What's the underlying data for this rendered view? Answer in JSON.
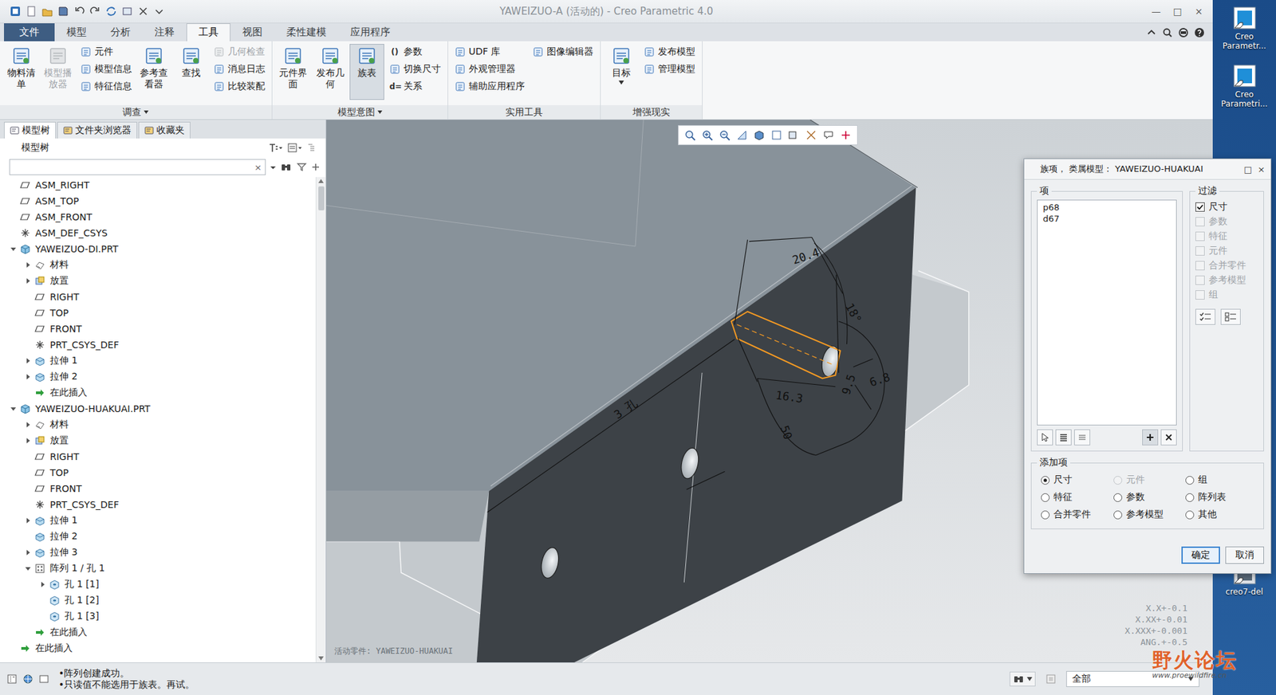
{
  "window": {
    "title": "YAWEIZUO-A (活动的) - Creo Parametric 4.0",
    "controls": [
      "—",
      "□",
      "×"
    ]
  },
  "ribbon": {
    "tabs": [
      {
        "label": "文件",
        "selected": false,
        "kind": "file"
      },
      {
        "label": "模型",
        "selected": false,
        "kind": "tab"
      },
      {
        "label": "分析",
        "selected": false,
        "kind": "tab"
      },
      {
        "label": "注释",
        "selected": false,
        "kind": "tab"
      },
      {
        "label": "工具",
        "selected": true,
        "kind": "tab"
      },
      {
        "label": "视图",
        "selected": false,
        "kind": "tab"
      },
      {
        "label": "柔性建模",
        "selected": false,
        "kind": "tab"
      },
      {
        "label": "应用程序",
        "selected": false,
        "kind": "tab"
      }
    ],
    "groups": [
      {
        "title": "调查",
        "dropdown": true,
        "items": [
          {
            "kind": "large",
            "label": "物料清单",
            "disabled": false,
            "selected": false,
            "menu": false
          },
          {
            "kind": "large",
            "label": "模型播放器",
            "disabled": true,
            "selected": false,
            "menu": false
          },
          {
            "kind": "column",
            "buttons": [
              {
                "label": "元件",
                "disabled": false
              },
              {
                "label": "模型信息",
                "disabled": false
              },
              {
                "label": "特征信息",
                "disabled": false
              }
            ]
          },
          {
            "kind": "large",
            "label": "参考查看器",
            "disabled": false,
            "selected": false,
            "menu": false
          },
          {
            "kind": "large",
            "label": "查找",
            "disabled": false,
            "selected": false,
            "menu": false
          },
          {
            "kind": "column",
            "buttons": [
              {
                "label": "几何检查",
                "disabled": true
              },
              {
                "label": "消息日志",
                "disabled": false
              },
              {
                "label": "比较装配",
                "disabled": false
              }
            ]
          }
        ]
      },
      {
        "title": "模型意图",
        "dropdown": true,
        "items": [
          {
            "kind": "large",
            "label": "元件界面",
            "disabled": false,
            "selected": false,
            "menu": false
          },
          {
            "kind": "large",
            "label": "发布几何",
            "disabled": false,
            "selected": false,
            "menu": false
          },
          {
            "kind": "large",
            "label": "族表",
            "disabled": false,
            "selected": true,
            "menu": false
          },
          {
            "kind": "column",
            "buttons": [
              {
                "label": "参数",
                "disabled": false,
                "glyph": "()"
              },
              {
                "label": "切换尺寸",
                "disabled": false
              },
              {
                "label": "关系",
                "disabled": false,
                "glyph": "d="
              }
            ]
          }
        ]
      },
      {
        "title": "实用工具",
        "dropdown": false,
        "items": [
          {
            "kind": "column",
            "buttons": [
              {
                "label": "UDF 库",
                "disabled": false
              },
              {
                "label": "外观管理器",
                "disabled": false
              },
              {
                "label": "辅助应用程序",
                "disabled": false
              }
            ]
          },
          {
            "kind": "column",
            "buttons": [
              {
                "label": "图像编辑器",
                "disabled": false
              }
            ]
          }
        ]
      },
      {
        "title": "增强现实",
        "dropdown": false,
        "items": [
          {
            "kind": "large",
            "label": "目标",
            "disabled": false,
            "selected": false,
            "menu": true
          },
          {
            "kind": "column",
            "buttons": [
              {
                "label": "发布模型",
                "disabled": false
              },
              {
                "label": "管理模型",
                "disabled": false
              }
            ]
          }
        ]
      }
    ]
  },
  "panel": {
    "tabs": [
      {
        "label": "模型树",
        "selected": true
      },
      {
        "label": "文件夹浏览器",
        "selected": false
      },
      {
        "label": "收藏夹",
        "selected": false
      }
    ],
    "header": "模型树",
    "search": {
      "value": "",
      "clear": "×"
    },
    "tree": [
      {
        "label": "ASM_RIGHT",
        "level": 0,
        "kind": "plane",
        "expandable": false,
        "expanded": false
      },
      {
        "label": "ASM_TOP",
        "level": 0,
        "kind": "plane",
        "expandable": false,
        "expanded": false
      },
      {
        "label": "ASM_FRONT",
        "level": 0,
        "kind": "plane",
        "expandable": false,
        "expanded": false
      },
      {
        "label": "ASM_DEF_CSYS",
        "level": 0,
        "kind": "csys",
        "expandable": false,
        "expanded": false
      },
      {
        "label": "YAWEIZUO-DI.PRT",
        "level": 0,
        "kind": "part",
        "expandable": true,
        "expanded": true
      },
      {
        "label": "材料",
        "level": 1,
        "kind": "material",
        "expandable": true,
        "expanded": false
      },
      {
        "label": "放置",
        "level": 1,
        "kind": "placement",
        "expandable": true,
        "expanded": false
      },
      {
        "label": "RIGHT",
        "level": 1,
        "kind": "plane",
        "expandable": false,
        "expanded": false
      },
      {
        "label": "TOP",
        "level": 1,
        "kind": "plane",
        "expandable": false,
        "expanded": false
      },
      {
        "label": "FRONT",
        "level": 1,
        "kind": "plane",
        "expandable": false,
        "expanded": false
      },
      {
        "label": "PRT_CSYS_DEF",
        "level": 1,
        "kind": "csys",
        "expandable": false,
        "expanded": false
      },
      {
        "label": "拉伸 1",
        "level": 1,
        "kind": "extrude",
        "expandable": true,
        "expanded": false
      },
      {
        "label": "拉伸 2",
        "level": 1,
        "kind": "extrude",
        "expandable": true,
        "expanded": false
      },
      {
        "label": "在此插入",
        "level": 1,
        "kind": "insert",
        "expandable": false,
        "expanded": false
      },
      {
        "label": "YAWEIZUO-HUAKUAI.PRT",
        "level": 0,
        "kind": "part",
        "expandable": true,
        "expanded": true
      },
      {
        "label": "材料",
        "level": 1,
        "kind": "material",
        "expandable": true,
        "expanded": false
      },
      {
        "label": "放置",
        "level": 1,
        "kind": "placement",
        "expandable": true,
        "expanded": false
      },
      {
        "label": "RIGHT",
        "level": 1,
        "kind": "plane",
        "expandable": false,
        "expanded": false
      },
      {
        "label": "TOP",
        "level": 1,
        "kind": "plane",
        "expandable": false,
        "expanded": false
      },
      {
        "label": "FRONT",
        "level": 1,
        "kind": "plane",
        "expandable": false,
        "expanded": false
      },
      {
        "label": "PRT_CSYS_DEF",
        "level": 1,
        "kind": "csys",
        "expandable": false,
        "expanded": false
      },
      {
        "label": "拉伸 1",
        "level": 1,
        "kind": "extrude",
        "expandable": true,
        "expanded": false
      },
      {
        "label": "拉伸 2",
        "level": 1,
        "kind": "extrude",
        "expandable": false,
        "expanded": false
      },
      {
        "label": "拉伸 3",
        "level": 1,
        "kind": "extrude",
        "expandable": true,
        "expanded": false
      },
      {
        "label": "阵列 1 / 孔 1",
        "level": 1,
        "kind": "pattern",
        "expandable": true,
        "expanded": true
      },
      {
        "label": "孔 1 [1]",
        "level": 2,
        "kind": "hole",
        "expandable": true,
        "expanded": false
      },
      {
        "label": "孔 1 [2]",
        "level": 2,
        "kind": "hole",
        "expandable": false,
        "expanded": false
      },
      {
        "label": "孔 1 [3]",
        "level": 2,
        "kind": "hole",
        "expandable": false,
        "expanded": false
      },
      {
        "label": "在此插入",
        "level": 1,
        "kind": "insert",
        "expandable": false,
        "expanded": false
      },
      {
        "label": "在此插入",
        "level": 0,
        "kind": "insert",
        "expandable": false,
        "expanded": false
      }
    ]
  },
  "graphics": {
    "active_part": "活动零件: YAWEIZUO-HUAKUAI",
    "dimensions": [
      "20.4",
      "18°",
      "16.3",
      "3 孔",
      "50",
      "6.8",
      "9.5"
    ],
    "tolerances": [
      "X.X+-0.1",
      "X.XX+-0.01",
      "X.XXX+-0.001",
      "ANG.+-0.5"
    ]
  },
  "dialog": {
    "title": "族项， 类属模型： YAWEIZUO-HUAKUAI",
    "controls": [
      "□",
      "×"
    ],
    "items_label": "项",
    "items": [
      {
        "label": "p68",
        "selected": false
      },
      {
        "label": "d67",
        "selected": false
      }
    ],
    "filter_label": "过滤",
    "filters": [
      {
        "label": "尺寸",
        "checked": true,
        "disabled": false
      },
      {
        "label": "参数",
        "checked": false,
        "disabled": true
      },
      {
        "label": "特征",
        "checked": false,
        "disabled": true
      },
      {
        "label": "元件",
        "checked": false,
        "disabled": true
      },
      {
        "label": "合并零件",
        "checked": false,
        "disabled": true
      },
      {
        "label": "参考模型",
        "checked": false,
        "disabled": true
      },
      {
        "label": "组",
        "checked": false,
        "disabled": true
      }
    ],
    "add_label": "添加项",
    "add_options": [
      {
        "label": "尺寸",
        "selected": true,
        "disabled": false
      },
      {
        "label": "元件",
        "selected": false,
        "disabled": true
      },
      {
        "label": "组",
        "selected": false,
        "disabled": false
      },
      {
        "label": "特征",
        "selected": false,
        "disabled": false
      },
      {
        "label": "参数",
        "selected": false,
        "disabled": false
      },
      {
        "label": "阵列表",
        "selected": false,
        "disabled": false
      },
      {
        "label": "合并零件",
        "selected": false,
        "disabled": false
      },
      {
        "label": "参考模型",
        "selected": false,
        "disabled": false
      },
      {
        "label": "其他",
        "selected": false,
        "disabled": false
      }
    ],
    "buttons": [
      {
        "label": "确定",
        "default": true
      },
      {
        "label": "取消",
        "default": false
      }
    ]
  },
  "status_bar": {
    "messages": [
      "•阵列创建成功。",
      "•只读值不能选用于族表。再试。"
    ],
    "filter": "全部"
  },
  "desktop": {
    "icons": [
      {
        "label": "Creo Parametr..."
      },
      {
        "label": "Creo Parametri..."
      },
      {
        "label": "creo7-del"
      }
    ],
    "watermark": {
      "logo": "野火论坛",
      "url": "www.proewildfire.cn"
    }
  }
}
